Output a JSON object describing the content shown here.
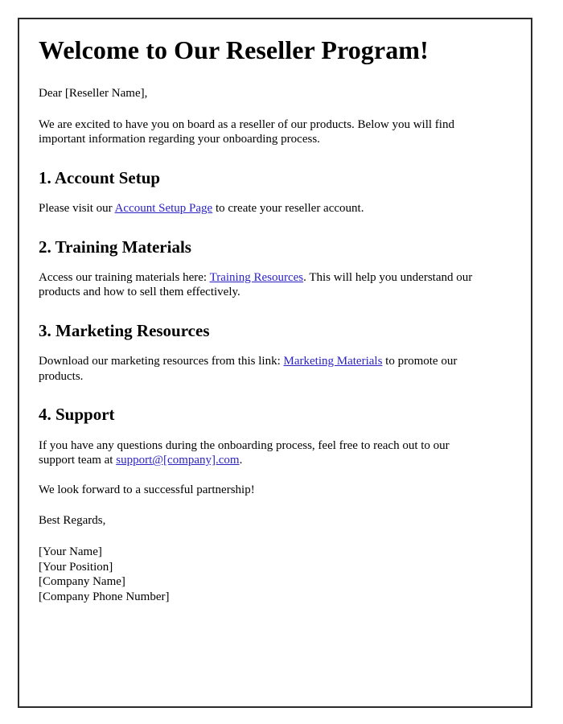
{
  "document": {
    "title": "Welcome to Our Reseller Program!",
    "salutation": "Dear [Reseller Name],",
    "intro": "We are excited to have you on board as a reseller of our products. Below you will find important information regarding your onboarding process.",
    "closing_line": "We look forward to a successful partnership!",
    "sign_off": "Best Regards,"
  },
  "link_color": "#2b22c4",
  "border_color": "#2b2b2b",
  "sections": [
    {
      "heading": "1. Account Setup",
      "body_before": "Please visit our ",
      "link_text": "Account Setup Page",
      "body_after": " to create your reseller account."
    },
    {
      "heading": "2. Training Materials",
      "body_before": "Access our training materials here: ",
      "link_text": "Training Resources",
      "body_after": ". This will help you understand our products and how to sell them effectively."
    },
    {
      "heading": "3. Marketing Resources",
      "body_before": "Download our marketing resources from this link: ",
      "link_text": "Marketing Materials",
      "body_after": " to promote our products."
    },
    {
      "heading": "4. Support",
      "body_before": "If you have any questions during the onboarding process, feel free to reach out to our support team at ",
      "link_text": "support@[company].com",
      "body_after": "."
    }
  ],
  "signature": [
    "[Your Name]",
    "[Your Position]",
    "[Company Name]",
    "[Company Phone Number]"
  ]
}
